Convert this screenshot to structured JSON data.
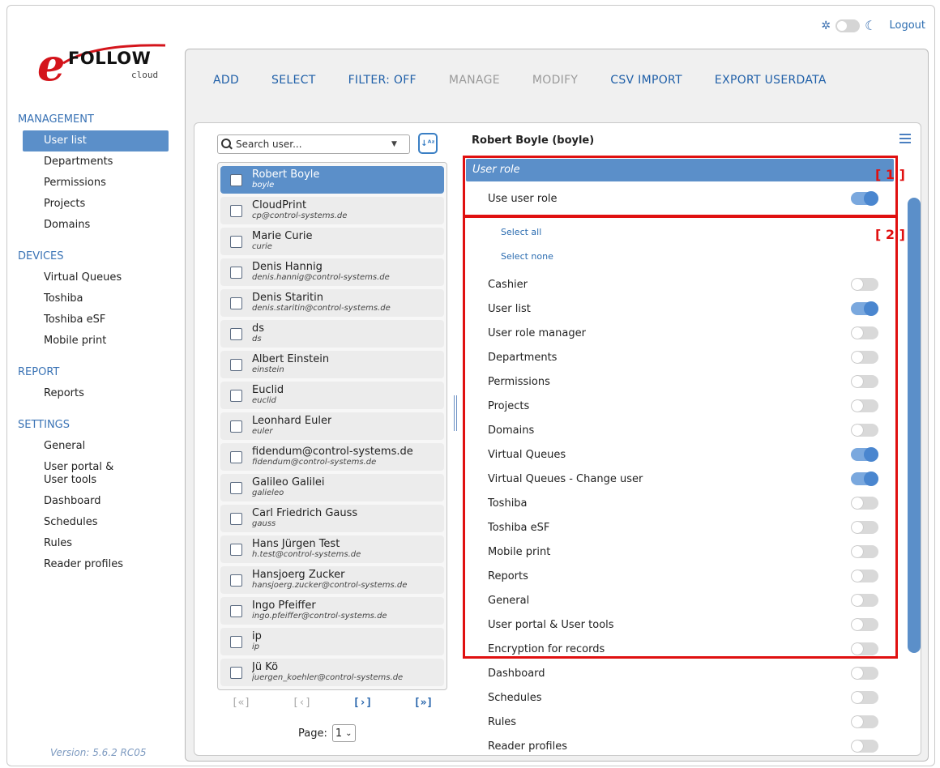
{
  "header": {
    "logout_label": "Logout"
  },
  "logo": {
    "brand_word": "FOLLOW",
    "brand_letter": "e",
    "brand_sub": "cloud"
  },
  "sidebar": {
    "sections": [
      {
        "title": "MANAGEMENT",
        "items": [
          "User list",
          "Departments",
          "Permissions",
          "Projects",
          "Domains"
        ],
        "active": "User list"
      },
      {
        "title": "DEVICES",
        "items": [
          "Virtual Queues",
          "Toshiba",
          "Toshiba eSF",
          "Mobile print"
        ]
      },
      {
        "title": "REPORT",
        "items": [
          "Reports"
        ]
      },
      {
        "title": "SETTINGS",
        "items": [
          "General",
          "User portal &\nUser tools",
          "Dashboard",
          "Schedules",
          "Rules",
          "Reader profiles"
        ]
      }
    ],
    "version": "Version: 5.6.2 RC05"
  },
  "toolbar": {
    "add": "ADD",
    "select": "SELECT",
    "filter": "FILTER: OFF",
    "manage": "MANAGE",
    "modify": "MODIFY",
    "csv_import": "CSV IMPORT",
    "export": "EXPORT USERDATA"
  },
  "search": {
    "placeholder": "Search user..."
  },
  "users": [
    {
      "name": "Robert Boyle",
      "login": "boyle",
      "selected": true
    },
    {
      "name": "CloudPrint",
      "login": "cp@control-systems.de"
    },
    {
      "name": "Marie Curie",
      "login": "curie"
    },
    {
      "name": "Denis Hannig",
      "login": "denis.hannig@control-systems.de"
    },
    {
      "name": "Denis Staritin",
      "login": "denis.staritin@control-systems.de"
    },
    {
      "name": "ds",
      "login": "ds"
    },
    {
      "name": "Albert Einstein",
      "login": "einstein"
    },
    {
      "name": "Euclid",
      "login": "euclid"
    },
    {
      "name": "Leonhard Euler",
      "login": "euler"
    },
    {
      "name": "fidendum@control-systems.de",
      "login": "fidendum@control-systems.de"
    },
    {
      "name": "Galileo Galilei",
      "login": "galieleo"
    },
    {
      "name": "Carl Friedrich Gauss",
      "login": "gauss"
    },
    {
      "name": "Hans Jürgen Test",
      "login": "h.test@control-systems.de"
    },
    {
      "name": "Hansjoerg Zucker",
      "login": "hansjoerg.zucker@control-systems.de"
    },
    {
      "name": "Ingo Pfeiffer",
      "login": "ingo.pfeiffer@control-systems.de"
    },
    {
      "name": "ip",
      "login": "ip"
    },
    {
      "name": "Jü Kö",
      "login": "juergen_koehler@control-systems.de"
    }
  ],
  "pager": {
    "first": "[«]",
    "prev": "[‹]",
    "next": "[›]",
    "last": "[»]",
    "page_label": "Page:",
    "page_value": "1"
  },
  "detail": {
    "title": "Robert Boyle (boyle)",
    "role_header": "User role",
    "use_user_role": {
      "label": "Use user role",
      "on": true
    },
    "select_all": "Select all",
    "select_none": "Select none",
    "permissions": [
      {
        "label": "Cashier",
        "on": false
      },
      {
        "label": "User list",
        "on": true
      },
      {
        "label": "User role manager",
        "on": false
      },
      {
        "label": "Departments",
        "on": false
      },
      {
        "label": "Permissions",
        "on": false
      },
      {
        "label": "Projects",
        "on": false
      },
      {
        "label": "Domains",
        "on": false
      },
      {
        "label": "Virtual Queues",
        "on": true
      },
      {
        "label": "Virtual Queues - Change user",
        "on": true
      },
      {
        "label": "Toshiba",
        "on": false
      },
      {
        "label": "Toshiba eSF",
        "on": false
      },
      {
        "label": "Mobile print",
        "on": false
      },
      {
        "label": "Reports",
        "on": false
      },
      {
        "label": "General",
        "on": false
      },
      {
        "label": "User portal & User tools",
        "on": false
      },
      {
        "label": "Encryption for records",
        "on": false
      },
      {
        "label": "Dashboard",
        "on": false
      },
      {
        "label": "Schedules",
        "on": false
      },
      {
        "label": "Rules",
        "on": false
      },
      {
        "label": "Reader profiles",
        "on": false
      }
    ]
  },
  "callouts": {
    "one": "[ 1 ]",
    "two": "[ 2 ]"
  },
  "colors": {
    "accent": "#5b8fc9",
    "link": "#1f5fa8",
    "callout": "#e01010",
    "brand_red": "#d4141b"
  }
}
